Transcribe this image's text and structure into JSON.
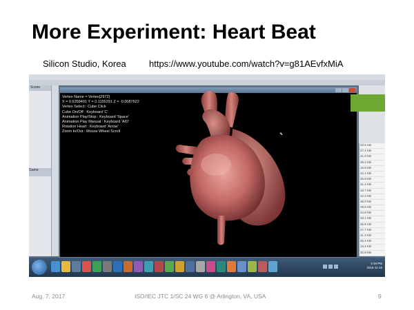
{
  "slide": {
    "title": "More Experiment: Heart Beat",
    "subtitle_left": "Silicon Studio, Korea",
    "subtitle_right": "https://www.youtube.com/watch?v=g81AEvfxMiA"
  },
  "viewer": {
    "info_lines": [
      "Vertex Name = Vertex[2972]",
      "X = 0.6358491 Y = 0.1155291 Z = -0.0087622",
      "Vertex Select : Cube Click",
      "Cube On/Off : Keyboard 'C'",
      "Animation Play/Stop : Keyboard 'Space'",
      "Animation Play Manual : Keyboard 'A/D'",
      "Rotation Heart : Keyboard 'Arrow'",
      "Zoom In/Out : Mouse Wheel Scroll"
    ]
  },
  "left_panel": {
    "header": "Scene",
    "box2": "Game"
  },
  "right_panel": {
    "rows": [
      "23.5 KB",
      "27.4 KB",
      "21.0 KB",
      "38.2 KB",
      "19.8 KB",
      "42.1 KB",
      "26.9 KB",
      "31.4 KB",
      "18.7 KB",
      "22.3 KB",
      "36.0 KB",
      "29.5 KB",
      "24.8 KB",
      "33.1 KB",
      "20.6 KB",
      "27.7 KB",
      "41.3 KB",
      "25.2 KB",
      "19.4 KB",
      "30.8 KB",
      "22.9 KB",
      "35.6 KB"
    ]
  },
  "taskbar": {
    "time": "4:16 PM",
    "date": "2016-11-16"
  },
  "footer": {
    "date": "Aug. 7, 2017",
    "center": "ISO/IEC JTC 1/SC 24 WG 6 @ Arlington, VA, USA",
    "page": "9"
  },
  "colors": {
    "accent_green": "#6ea832",
    "taskbar": "#2c4560",
    "viewer_bg": "#000000"
  }
}
